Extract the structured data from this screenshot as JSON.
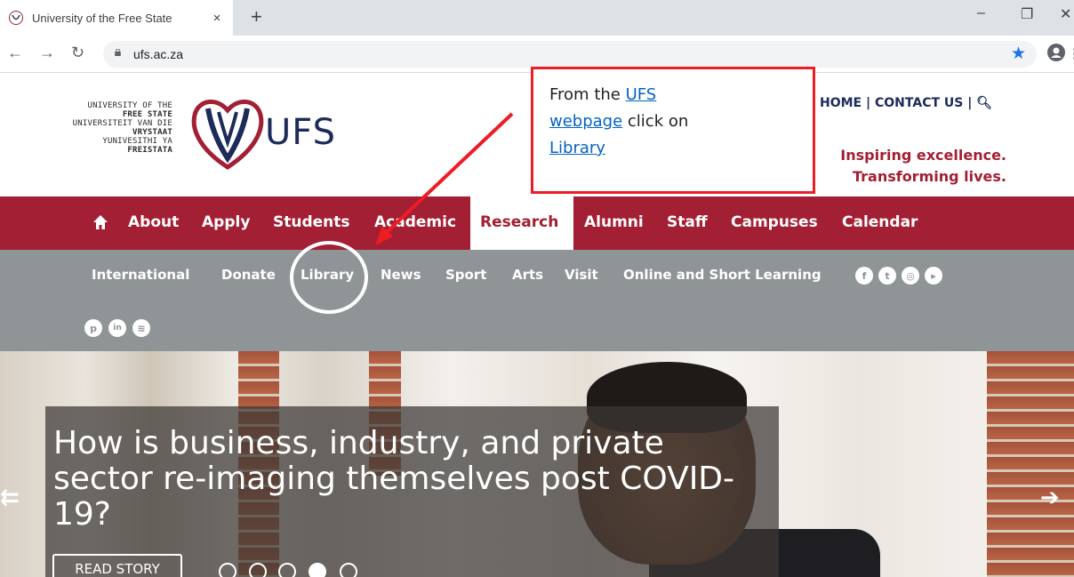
{
  "browser": {
    "tab_title": "University of the Free State",
    "tab_close": "×",
    "new_tab": "+",
    "url": "ufs.ac.za",
    "win_min": "–",
    "win_max": "❐",
    "win_close": "✕"
  },
  "header": {
    "logo_lines": [
      "UNIVERSITY OF THE",
      "FREE STATE",
      "UNIVERSITEIT VAN DIE",
      "VRYSTAAT",
      "YUNIVESITHI YA",
      "FREISTATA"
    ],
    "logo_word": "UFS",
    "top_links": [
      "HOME",
      "|",
      "CONTACT US",
      "|"
    ],
    "tagline_1": "Inspiring excellence.",
    "tagline_2": "Transforming lives."
  },
  "callout": {
    "prefix": "From the ",
    "link_ufs": "UFS",
    "link_webpage": "webpage",
    "middle": " click on",
    "link_library": "Library"
  },
  "main_nav": {
    "items": [
      "About",
      "Apply",
      "Students",
      "Academic",
      "Research",
      "Alumni",
      "Staff",
      "Campuses",
      "Calendar"
    ],
    "active": "Research"
  },
  "sub_nav": {
    "items": [
      "International",
      "Donate",
      "Library",
      "News",
      "Sport",
      "Arts",
      "Visit",
      "Online and Short Learning"
    ],
    "social_icons": [
      "facebook-icon",
      "twitter-icon",
      "instagram-icon",
      "youtube-icon",
      "pinterest-icon",
      "linkedin-icon",
      "rss-icon"
    ]
  },
  "hero": {
    "headline": "How is business, industry, and private sector re-imaging themselves post COVID-19?",
    "button": "READ STORY",
    "slides": 5,
    "active_slide": 4
  },
  "colors": {
    "brand_red": "#a31f34",
    "navy": "#1c2b5a",
    "subnav_gray": "#8f9497",
    "callout_border": "#ee1c25",
    "link_blue": "#0563c1"
  }
}
